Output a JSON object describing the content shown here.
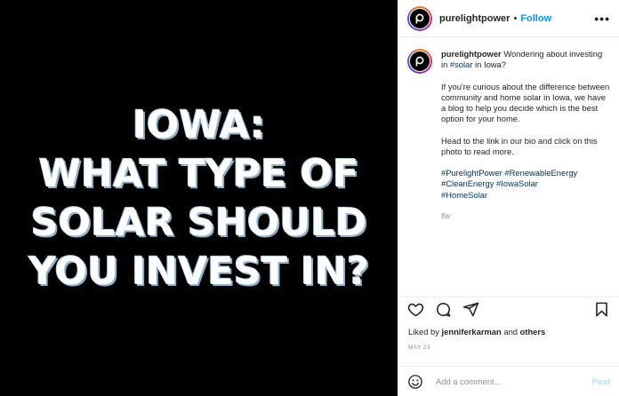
{
  "media": {
    "lines": [
      "IOWA:",
      "WHAT TYPE OF",
      "SOLAR SHOULD",
      "YOU INVEST IN?"
    ]
  },
  "header": {
    "username": "purelightpower",
    "separator": "•",
    "follow_label": "Follow",
    "more_label": "•••"
  },
  "caption": {
    "username": "purelightpower",
    "line1_text": " Wondering about investing in ",
    "line1_tag": "#solar",
    "line1_end": " in Iowa?",
    "para2": "If you're curious about the difference between community and home solar in Iowa, we have a blog to help you decide which is the best option for your home.",
    "para3": "Head to the link in our bio and click on this photo to read more.",
    "hashtags": [
      "#PurelightPower",
      "#RenewableEnergy",
      "#CleanEnergy",
      "#IowaSolar",
      "#HomeSolar"
    ],
    "time_ago": "8w"
  },
  "actions": {
    "icons": [
      "heart-icon",
      "comment-icon",
      "share-icon",
      "bookmark-icon"
    ]
  },
  "likes": {
    "prefix": "Liked by ",
    "user": "jenniferkarman",
    "suffix": " and ",
    "others": "others"
  },
  "date": "MAY 23",
  "comment": {
    "placeholder": "Add a comment...",
    "post_label": "Post"
  },
  "colors": {
    "accent": "#0095f6",
    "hashtag": "#00376b",
    "muted": "#8e8e8e",
    "post_disabled": "#b2dffc"
  }
}
